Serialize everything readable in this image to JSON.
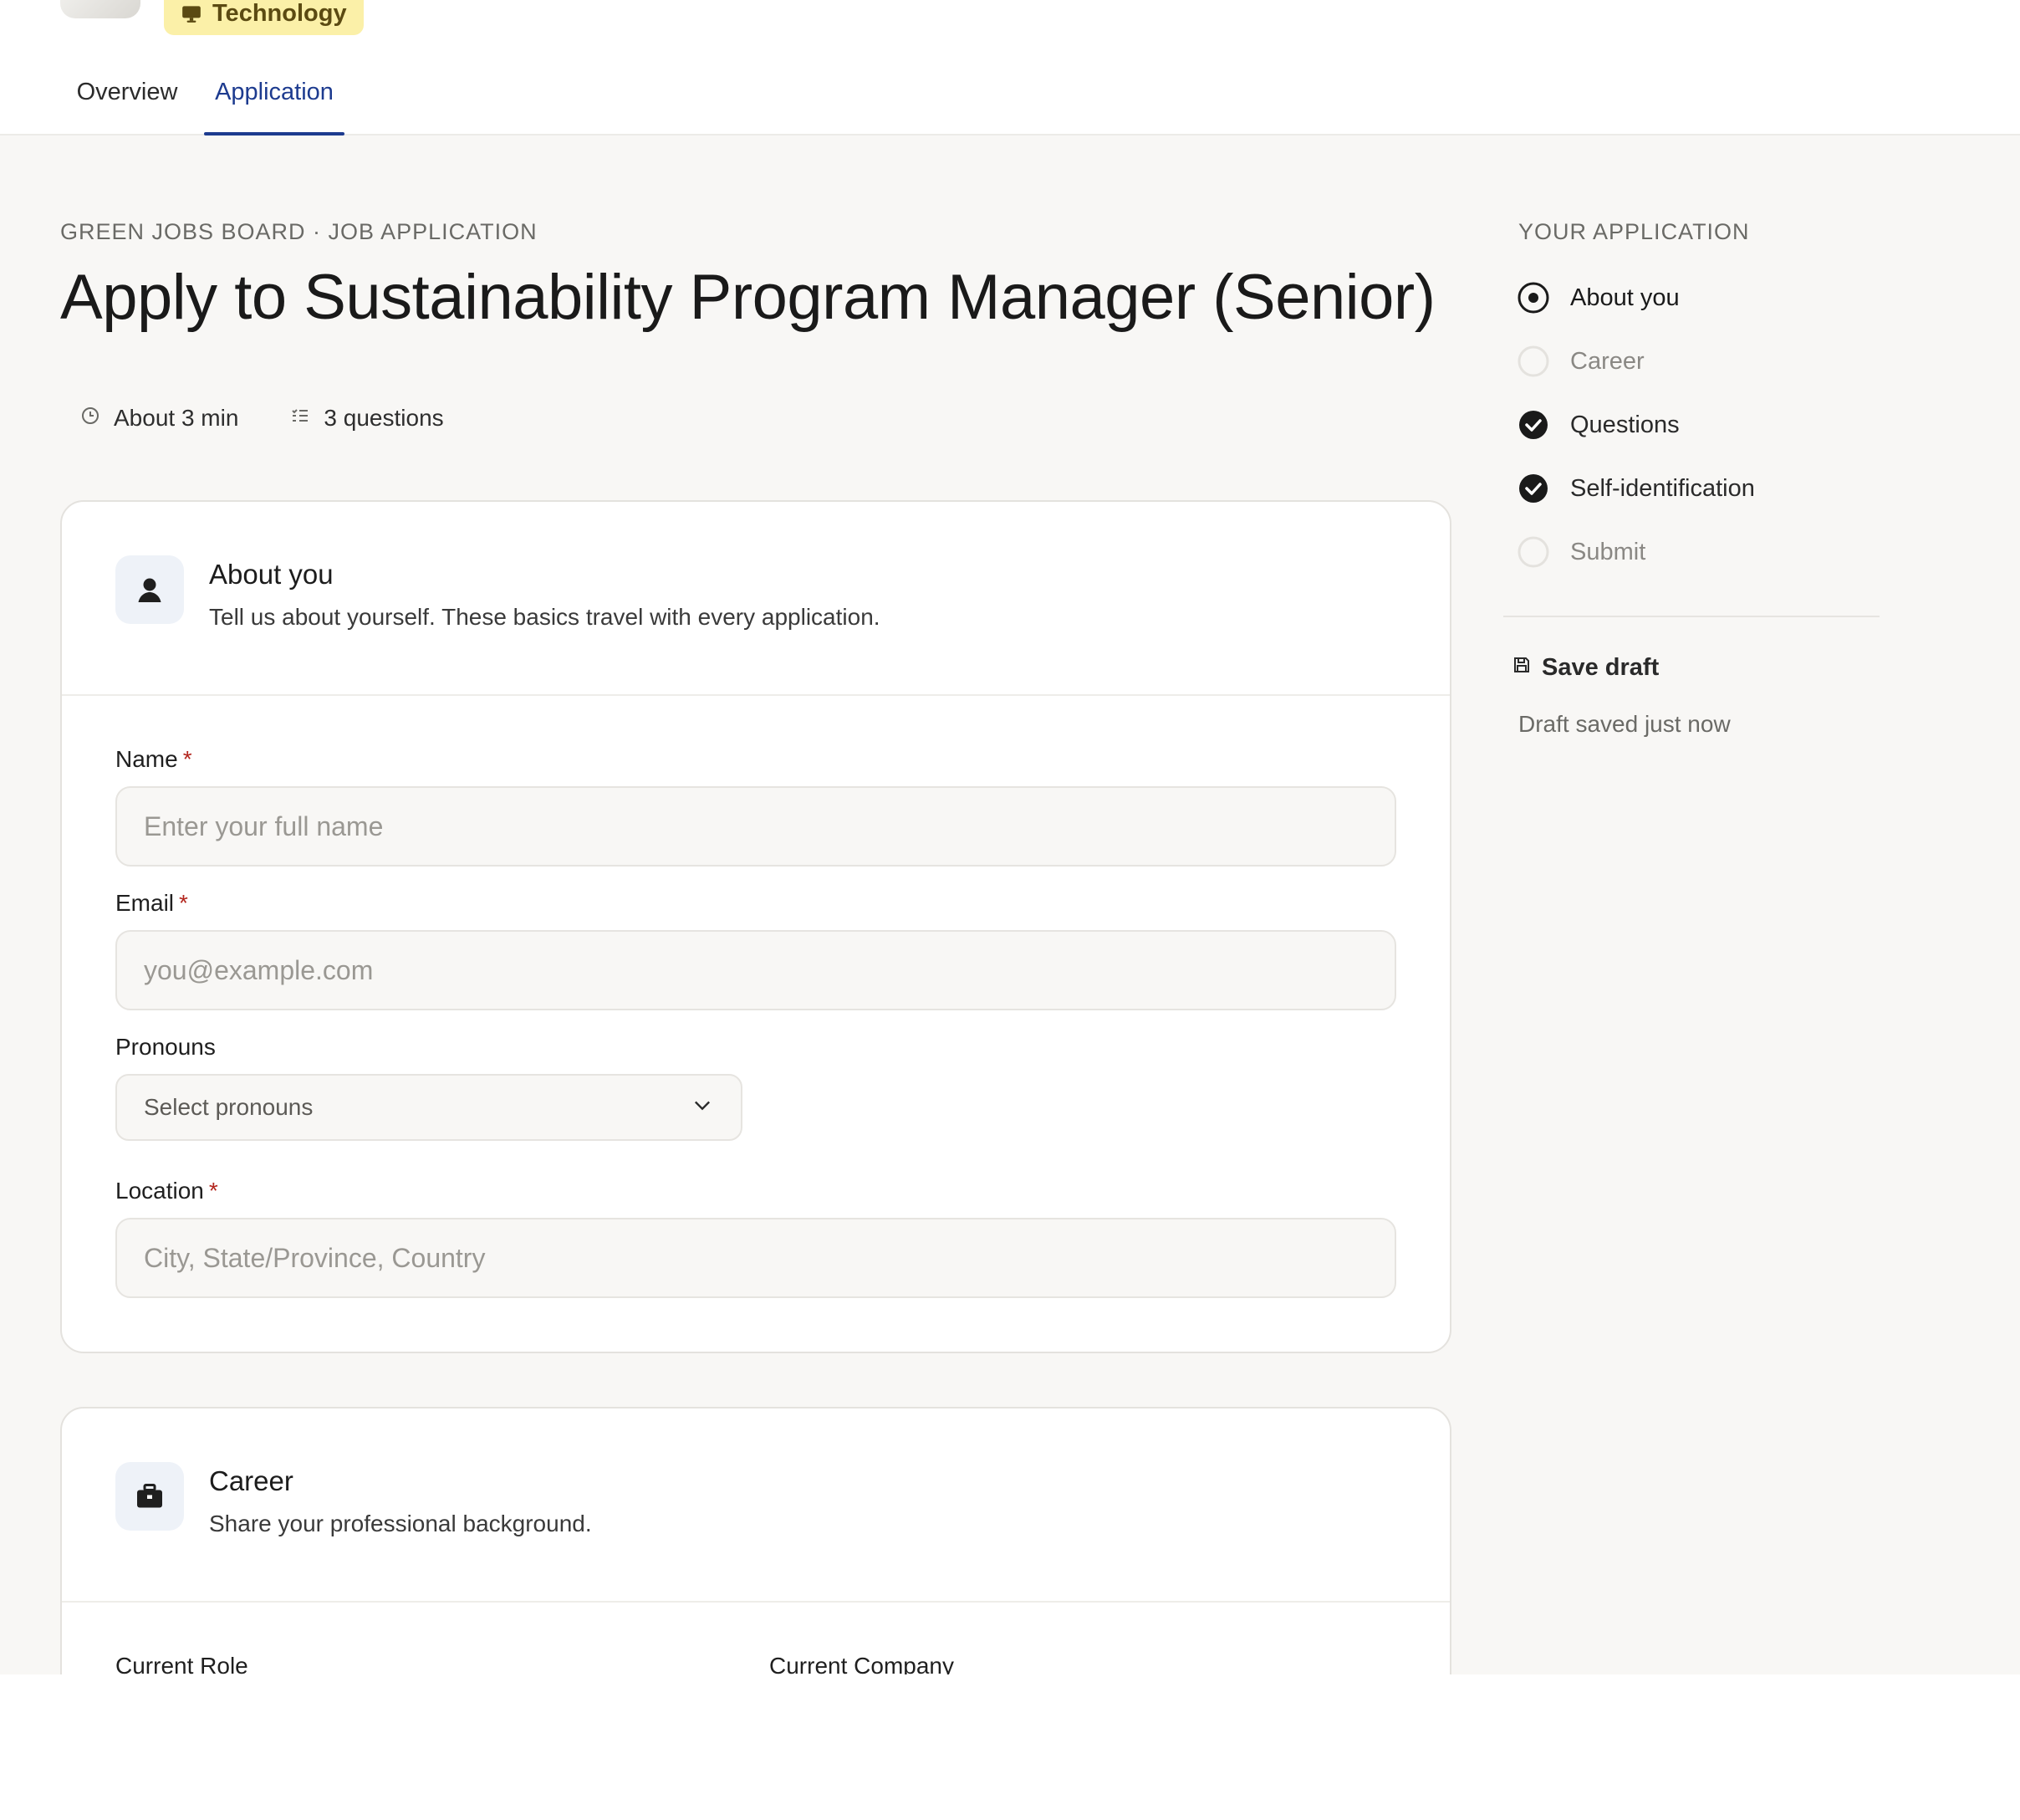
{
  "header": {
    "category_badge": "Technology",
    "tabs": [
      {
        "label": "Overview"
      },
      {
        "label": "Application"
      }
    ]
  },
  "main": {
    "eyebrow": "GREEN JOBS BOARD · JOB APPLICATION",
    "title": "Apply to Sustainability Program Manager (Senior)",
    "meta": {
      "duration": "About 3 min",
      "questions": "3 questions"
    },
    "about_card": {
      "title": "About you",
      "subtitle": "Tell us about yourself. These basics travel with every application.",
      "fields": {
        "name": {
          "label": "Name",
          "required_mark": "*",
          "placeholder": "Enter your full name",
          "value": ""
        },
        "email": {
          "label": "Email",
          "required_mark": "*",
          "placeholder": "you@example.com",
          "value": ""
        },
        "pronouns": {
          "label": "Pronouns",
          "selected": "Select pronouns"
        },
        "location": {
          "label": "Location",
          "required_mark": "*",
          "placeholder": "City, State/Province, Country",
          "value": ""
        }
      }
    },
    "career_card": {
      "title": "Career",
      "subtitle": "Share your professional background.",
      "fields": {
        "current_role": {
          "label": "Current Role"
        },
        "current_company": {
          "label": "Current Company"
        }
      }
    }
  },
  "sidebar": {
    "title": "YOUR APPLICATION",
    "steps": [
      {
        "label": "About you",
        "status": "current"
      },
      {
        "label": "Career",
        "status": "todo"
      },
      {
        "label": "Questions",
        "status": "done"
      },
      {
        "label": "Self-identification",
        "status": "done"
      },
      {
        "label": "Submit",
        "status": "todo"
      }
    ],
    "save_draft_label": "Save draft",
    "draft_status": "Draft saved just now"
  },
  "colors": {
    "accent": "#1d3b8f",
    "badge_bg": "#fbf0a8",
    "required": "#b3261e",
    "page_bg": "#f8f7f5"
  }
}
